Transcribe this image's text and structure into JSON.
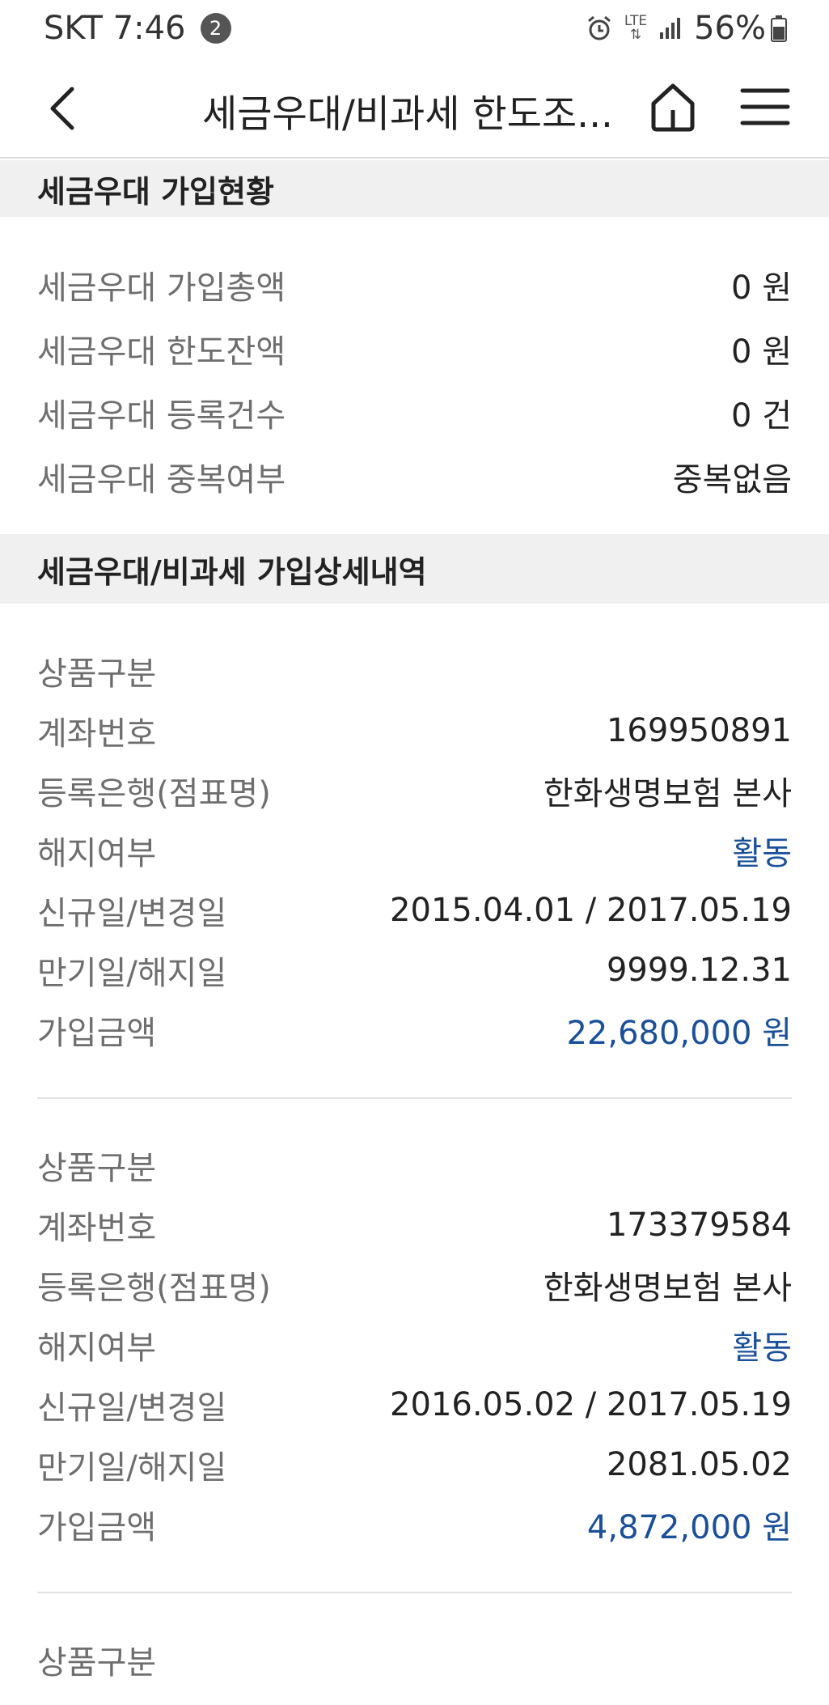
{
  "status": {
    "carrier_time": "SKT 7:46",
    "notification_count": "2",
    "network": "LTE",
    "battery": "56%"
  },
  "header": {
    "title": "세금우대/비과세 한도조..."
  },
  "summary": {
    "heading": "세금우대 가입현황",
    "rows": [
      {
        "label": "세금우대 가입총액",
        "value": "0 원"
      },
      {
        "label": "세금우대 한도잔액",
        "value": "0 원"
      },
      {
        "label": "세금우대 등록건수",
        "value": "0 건"
      },
      {
        "label": "세금우대 중복여부",
        "value": "중복없음"
      }
    ]
  },
  "details": {
    "heading": "세금우대/비과세 가입상세내역",
    "labels": {
      "product_type": "상품구분",
      "account_number": "계좌번호",
      "bank": "등록은행(점표명)",
      "cancel_status": "해지여부",
      "new_changed_date": "신규일/변경일",
      "maturity_cancel_date": "만기일/해지일",
      "amount": "가입금액"
    },
    "items": [
      {
        "product_type": "",
        "account_number": "169950891",
        "bank": "한화생명보험 본사",
        "cancel_status": "활동",
        "new_changed_date": "2015.04.01 / 2017.05.19",
        "maturity_cancel_date": "9999.12.31",
        "amount": "22,680,000 원"
      },
      {
        "product_type": "",
        "account_number": "173379584",
        "bank": "한화생명보험 본사",
        "cancel_status": "활동",
        "new_changed_date": "2016.05.02 / 2017.05.19",
        "maturity_cancel_date": "2081.05.02",
        "amount": "4,872,000 원"
      }
    ]
  },
  "colors": {
    "accent_blue": "#1a4f99",
    "label_gray": "#6e6e6e",
    "section_bg": "#f0f0f0"
  },
  "icons": [
    "back-arrow-icon",
    "home-icon",
    "menu-icon",
    "alarm-icon",
    "signal-icon",
    "battery-icon"
  ]
}
